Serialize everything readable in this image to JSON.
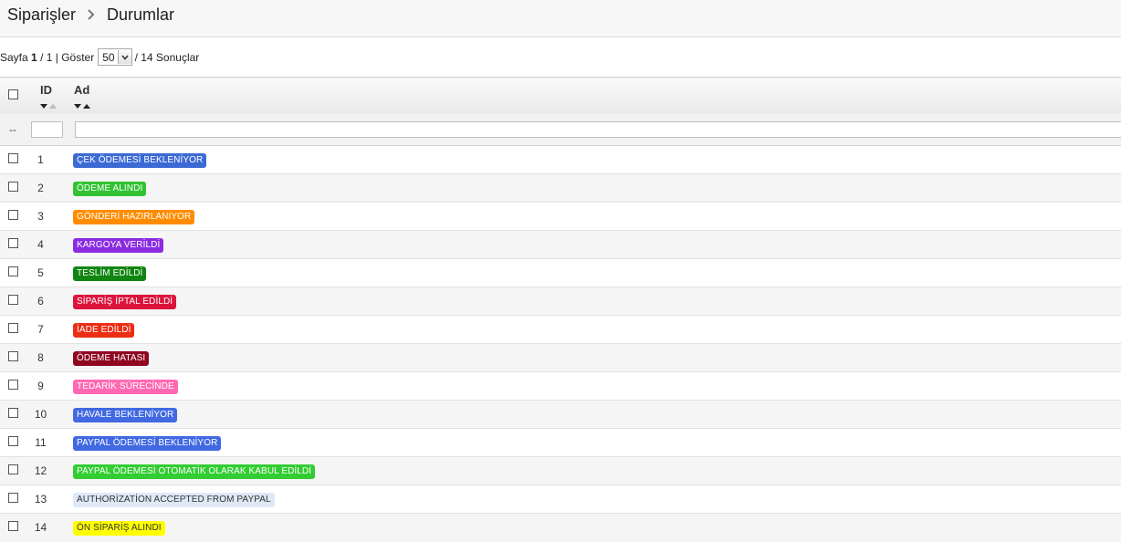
{
  "breadcrumb": {
    "parent": "Siparişler",
    "current": "Durumlar"
  },
  "pager": {
    "page_label": "Sayfa",
    "page": "1",
    "total_pages": "/ 1 |",
    "show_label": "Göster",
    "per_page": "50",
    "results": "/ 14 Sonuçlar"
  },
  "columns": {
    "id": "ID",
    "name": "Ad"
  },
  "filter": {
    "dash": "--"
  },
  "rows": [
    {
      "id": "1",
      "name": "ÇEK ÖDEMESİ BEKLENİYOR",
      "color": "#3c6ad4"
    },
    {
      "id": "2",
      "name": "ÖDEME ALINDI",
      "color": "#32c232"
    },
    {
      "id": "3",
      "name": "GÖNDERİ HAZIRLANIYOR",
      "color": "#ff8c00"
    },
    {
      "id": "4",
      "name": "KARGOYA VERİLDİ",
      "color": "#8a2be2"
    },
    {
      "id": "5",
      "name": "TESLİM EDİLDİ",
      "color": "#108510"
    },
    {
      "id": "6",
      "name": "SİPARİŞ İPTAL EDİLDİ",
      "color": "#dc143c"
    },
    {
      "id": "7",
      "name": "İADE EDİLDİ",
      "color": "#ec2e15"
    },
    {
      "id": "8",
      "name": "ÖDEME HATASI",
      "color": "#8f0621"
    },
    {
      "id": "9",
      "name": "TEDARİK SÜRECİNDE",
      "color": "#ff69b4"
    },
    {
      "id": "10",
      "name": "HAVALE BEKLENİYOR",
      "color": "#4169e1"
    },
    {
      "id": "11",
      "name": "PAYPAL ÖDEMESİ BEKLENİYOR",
      "color": "#4169e1"
    },
    {
      "id": "12",
      "name": "PAYPAL ÖDEMESİ OTOMATİK OLARAK KABUL EDİLDİ",
      "color": "#32cd32"
    },
    {
      "id": "13",
      "name": "AUTHORİZATİON ACCEPTED FROM PAYPAL",
      "color": "#dfe9f6",
      "dark_text": true
    },
    {
      "id": "14",
      "name": "ÖN SİPARİŞ ALINDI",
      "color": "#ffff00",
      "dark_text": true
    }
  ]
}
